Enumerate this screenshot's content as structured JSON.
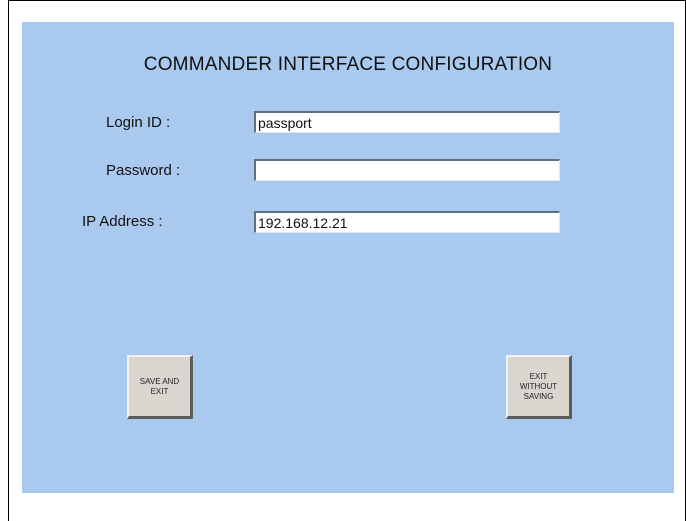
{
  "dialog": {
    "title": "COMMANDER INTERFACE CONFIGURATION",
    "fields": {
      "login": {
        "label": "Login ID :",
        "value": "passport"
      },
      "password": {
        "label": "Password :",
        "value": ""
      },
      "ip": {
        "label": "IP Address :",
        "value": "192.168.12.21"
      }
    },
    "buttons": {
      "save": "SAVE AND\nEXIT",
      "exit": "EXIT\nWITHOUT\nSAVING"
    }
  },
  "colors": {
    "panel_background": "#a9c9ee",
    "button_face": "#d9d6cf"
  }
}
